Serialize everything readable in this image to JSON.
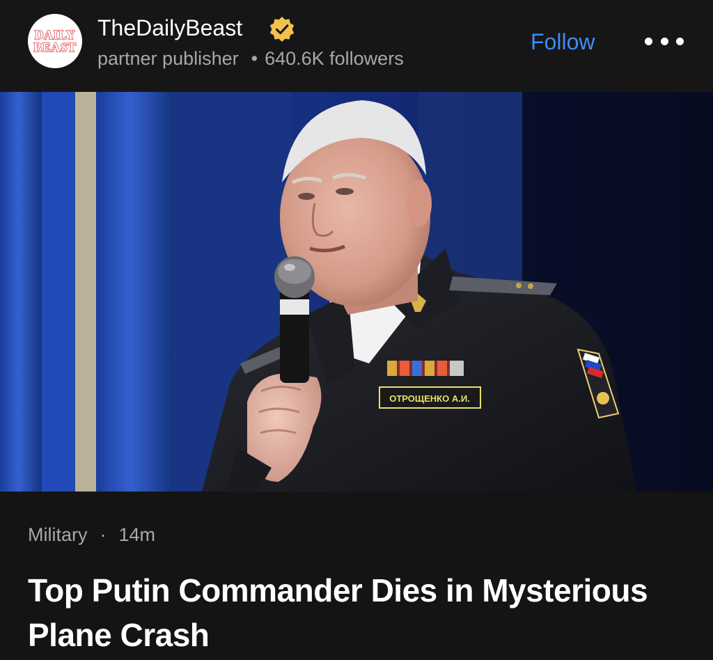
{
  "publisher": {
    "logo_text": [
      "DAILY",
      "BEAST"
    ],
    "name": "TheDailyBeast",
    "verified_icon": "verified-badge-icon",
    "label": "partner publisher",
    "separator": "•",
    "followers": "640.6K followers",
    "follow_label": "Follow",
    "more_icon": "more-horizontal-icon"
  },
  "photo": {
    "name_tag": "ОТРОЩЕНКО А.И."
  },
  "article": {
    "category": "Military",
    "separator": "·",
    "time": "14m",
    "headline": "Top Putin Commander Dies in Mysterious Plane Crash"
  },
  "colors": {
    "background": "#141414",
    "accent": "#3b8cf7",
    "secondary_text": "#a8a8a8",
    "verified_gold": "#f2c14e",
    "logo_red": "#d8262b"
  }
}
